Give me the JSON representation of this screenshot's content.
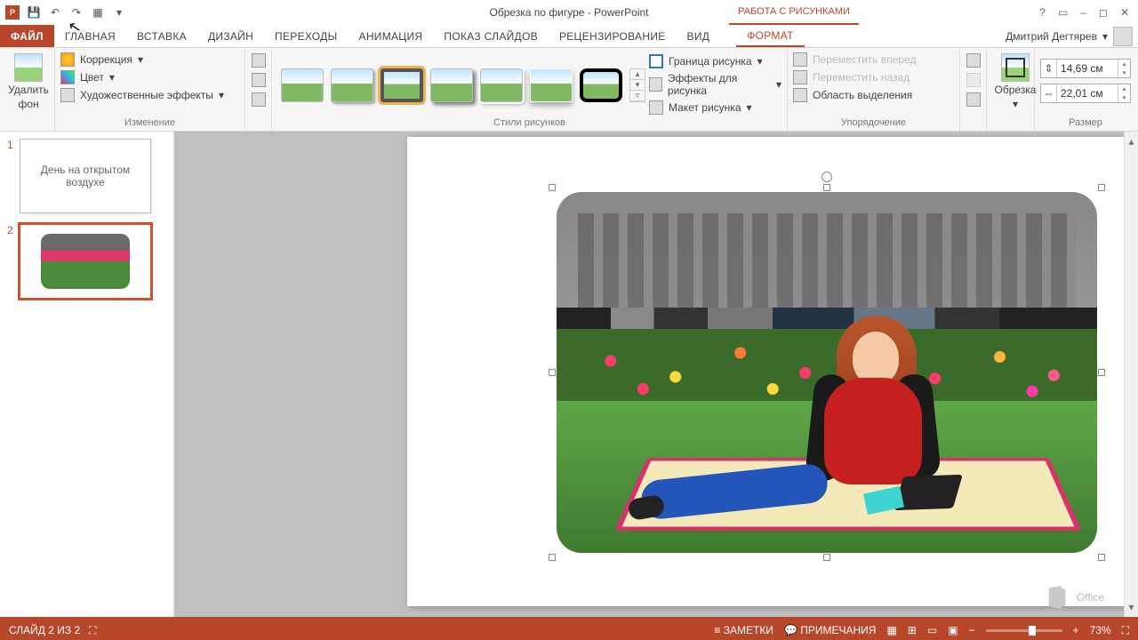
{
  "qat": {
    "undo": "↶",
    "redo": "↷",
    "save": "💾",
    "slideshow": "▦",
    "more": "▾"
  },
  "title": "Обрезка по фигуре - PowerPoint",
  "context_tab": "РАБОТА С РИСУНКАМИ",
  "window_buttons": {
    "help": "?",
    "ribbon": "▭",
    "min": "–",
    "max": "◻",
    "close": "✕"
  },
  "tabs": [
    "ФАЙЛ",
    "ГЛАВНАЯ",
    "ВСТАВКА",
    "ДИЗАЙН",
    "ПЕРЕХОДЫ",
    "АНИМАЦИЯ",
    "ПОКАЗ СЛАЙДОВ",
    "РЕЦЕНЗИРОВАНИЕ",
    "ВИД",
    "ФОРМАТ"
  ],
  "user": {
    "name": "Дмитрий Дегтярев"
  },
  "ribbon": {
    "remove_bg": {
      "line1": "Удалить",
      "line2": "фон"
    },
    "adjust": {
      "corrections": "Коррекция",
      "color": "Цвет",
      "artistic": "Художественные эффекты",
      "group": "Изменение"
    },
    "styles_group": "Стили рисунков",
    "border": "Граница рисунка",
    "effects": "Эффекты для рисунка",
    "layout": "Макет рисунка",
    "arrange": {
      "forward": "Переместить вперед",
      "backward": "Переместить назад",
      "selection": "Область выделения",
      "group": "Упорядочение"
    },
    "crop": {
      "label": "Обрезка"
    },
    "size": {
      "height": "14,69 см",
      "width": "22,01 см",
      "group": "Размер"
    }
  },
  "thumbs": {
    "n1": "1",
    "n2": "2",
    "slide1_text": "День на открытом воздухе"
  },
  "watermark": "Office",
  "status": {
    "slide": "СЛАЙД 2 ИЗ 2",
    "lang_icon": "⛶",
    "notes": "ЗАМЕТКИ",
    "comments": "ПРИМЕЧАНИЯ",
    "zoom": "73%",
    "fit": "⛶"
  }
}
